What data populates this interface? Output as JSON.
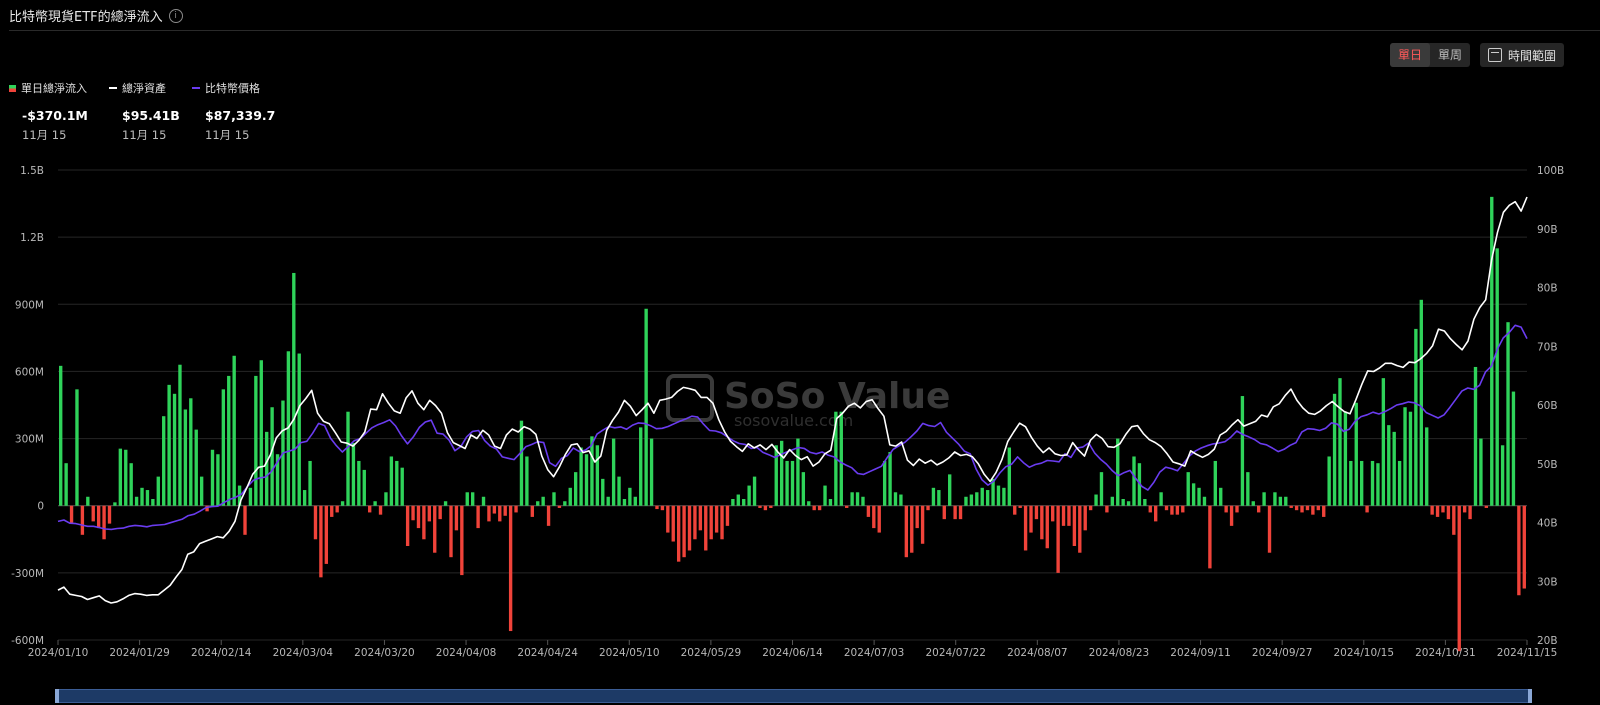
{
  "header": {
    "title": "比特幣現貨ETF的總淨流入",
    "info_icon": "info-icon"
  },
  "controls": {
    "daily_label": "單日",
    "weekly_label": "單周",
    "range_label": "時間範圍",
    "range_icon": "calendar-icon",
    "active_color": "#ff5a5a"
  },
  "legend": [
    {
      "label": "單日總淨流入",
      "value": "-$370.1M",
      "date": "11月 15"
    },
    {
      "label": "總淨資產",
      "value": "$95.41B",
      "date": "11月 15"
    },
    {
      "label": "比特幣價格",
      "value": "$87,339.7",
      "date": "11月 15"
    }
  ],
  "watermark": {
    "main": "SoSo Value",
    "sub": "sosovalue.com"
  },
  "colors": {
    "inflow": "#2fd35a",
    "outflow": "#f0433a",
    "net_assets": "#ffffff",
    "btc_price": "#6a3cf0"
  },
  "chart_data": {
    "type": "bar",
    "series": [
      {
        "name": "單日總淨流入",
        "type": "bar",
        "axis": "left",
        "unit": "USD",
        "values": [
          625,
          190,
          -75,
          520,
          -130,
          40,
          -70,
          -100,
          -150,
          -80,
          15,
          255,
          250,
          190,
          40,
          80,
          70,
          30,
          130,
          400,
          540,
          500,
          630,
          430,
          480,
          340,
          130,
          -25,
          250,
          230,
          520,
          580,
          670,
          90,
          -130,
          80,
          580,
          650,
          330,
          440,
          230,
          470,
          690,
          1040,
          680,
          70,
          200,
          -150,
          -320,
          -260,
          -50,
          -30,
          20,
          420,
          280,
          200,
          160,
          -30,
          20,
          -40,
          60,
          220,
          200,
          170,
          -180,
          -65,
          -100,
          -150,
          -70,
          -210,
          -60,
          20,
          -230,
          -110,
          -310,
          60,
          60,
          -100,
          40,
          -70,
          -35,
          -70,
          -45,
          -560,
          -30,
          380,
          220,
          -50,
          20,
          40,
          -90,
          60,
          -10,
          20,
          80,
          150,
          260,
          230,
          310,
          270,
          120,
          40,
          300,
          130,
          30,
          80,
          40,
          350,
          880,
          300,
          -15,
          -20,
          -120,
          -160,
          -250,
          -230,
          -200,
          -150,
          -110,
          -200,
          -150,
          -120,
          -150,
          -90,
          30,
          50,
          30,
          90,
          130,
          -10,
          -20,
          -10,
          270,
          290,
          200,
          200,
          300,
          150,
          20,
          -20,
          -20,
          90,
          30,
          420,
          420,
          -10,
          60,
          60,
          40,
          -50,
          -100,
          -120,
          200,
          240,
          60,
          50,
          -230,
          -210,
          -100,
          -170,
          -20,
          80,
          70,
          -60,
          140,
          -60,
          -60,
          40,
          50,
          60,
          80,
          70,
          120,
          90,
          80,
          260,
          -40,
          -10,
          -200,
          -120,
          -60,
          -150,
          -190,
          -70,
          -300,
          -90,
          -90,
          -180,
          -210,
          -110,
          -20,
          50,
          150,
          -30,
          40,
          300,
          30,
          20,
          220,
          190,
          30,
          -30,
          -70,
          60,
          -20,
          -40,
          -40,
          -30,
          150,
          100,
          80,
          40,
          -280,
          200,
          80,
          -30,
          -90,
          -30,
          490,
          150,
          20,
          -30,
          60,
          -210,
          60,
          40,
          40,
          -10,
          -20,
          -30,
          -20,
          -40,
          -20,
          -50,
          220,
          500,
          570,
          420,
          200,
          460,
          200,
          -30,
          200,
          190,
          570,
          360,
          330,
          200,
          440,
          420,
          790,
          920,
          350,
          -40,
          -50,
          -30,
          -60,
          -130,
          -650,
          -30,
          -60,
          620,
          300,
          -10,
          1380,
          1150,
          270,
          820,
          510,
          -400,
          -370
        ]
      },
      {
        "name": "總淨資產",
        "type": "line",
        "axis": "right",
        "unit": "B USD",
        "values": [
          28.5,
          29.0,
          27.8,
          27.6,
          27.4,
          26.9,
          27.2,
          27.5,
          26.7,
          26.3,
          26.5,
          27.0,
          27.6,
          27.9,
          27.8,
          27.6,
          27.7,
          27.7,
          28.5,
          29.3,
          30.7,
          32.0,
          34.6,
          35.0,
          36.4,
          36.8,
          37.2,
          37.6,
          37.4,
          38.5,
          40.2,
          43.8,
          45.9,
          48.2,
          49.4,
          49.6,
          51.5,
          54.4,
          55.6,
          56.1,
          57.6,
          59.9,
          61.1,
          62.5,
          58.6,
          57.2,
          56.8,
          55.3,
          53.7,
          53.5,
          53.0,
          54.0,
          55.4,
          59.3,
          59.2,
          61.9,
          60.3,
          59.0,
          58.6,
          61.2,
          62.4,
          60.3,
          59.2,
          60.8,
          59.9,
          58.6,
          55.3,
          53.6,
          53.1,
          52.6,
          54.9,
          54.3,
          55.7,
          54.9,
          53.0,
          52.6,
          54.9,
          55.9,
          55.4,
          56.3,
          55.9,
          55.0,
          51.3,
          49.0,
          47.8,
          49.5,
          51.6,
          53.2,
          53.4,
          51.9,
          52.2,
          50.3,
          51.3,
          55.7,
          57.4,
          58.8,
          60.8,
          59.8,
          58.2,
          59.2,
          60.3,
          58.6,
          60.8,
          61.0,
          61.3,
          62.3,
          63.0,
          62.8,
          62.5,
          61.3,
          61.3,
          60.3,
          57.5,
          55.4,
          53.8,
          52.9,
          52.1,
          53.4,
          52.7,
          53.2,
          52.4,
          53.3,
          52.0,
          51.0,
          52.4,
          51.4,
          50.7,
          51.2,
          49.6,
          50.3,
          51.7,
          52.3,
          57.7,
          58.6,
          59.8,
          60.3,
          59.5,
          60.6,
          60.9,
          59.4,
          58.1,
          53.2,
          53.0,
          53.7,
          50.6,
          49.7,
          50.8,
          50.1,
          50.6,
          49.8,
          50.3,
          51.0,
          52.0,
          51.4,
          51.6,
          51.2,
          50.0,
          48.2,
          47.0,
          48.5,
          50.7,
          53.8,
          55.4,
          56.9,
          56.3,
          54.5,
          53.0,
          51.9,
          52.7,
          51.7,
          51.4,
          51.5,
          53.6,
          52.3,
          51.3,
          54.0,
          55.0,
          54.3,
          52.9,
          52.8,
          53.4,
          55.0,
          56.3,
          56.5,
          55.1,
          54.1,
          53.6,
          52.9,
          51.7,
          50.3,
          50.0,
          49.6,
          52.2,
          51.6,
          51.1,
          51.6,
          52.5,
          54.9,
          55.5,
          56.6,
          57.5,
          56.4,
          56.8,
          57.2,
          58.3,
          58.0,
          59.7,
          60.2,
          61.6,
          62.7,
          60.8,
          59.5,
          58.6,
          58.4,
          59.0,
          59.9,
          60.6,
          59.7,
          58.9,
          58.5,
          60.9,
          63.5,
          65.8,
          65.7,
          66.3,
          67.1,
          67.1,
          66.7,
          66.4,
          67.3,
          67.2,
          67.9,
          68.8,
          70.1,
          72.9,
          72.6,
          71.3,
          70.3,
          69.4,
          70.9,
          74.6,
          76.6,
          77.9,
          84.7,
          89.4,
          92.8,
          94.0,
          94.6,
          93.0,
          95.41
        ]
      },
      {
        "name": "比特幣價格",
        "type": "line",
        "axis": "right",
        "unit": "USD",
        "values": [
          46500,
          46800,
          46100,
          46000,
          45700,
          45400,
          45400,
          45100,
          44800,
          44700,
          44900,
          45000,
          45400,
          45600,
          45500,
          45300,
          45600,
          45700,
          45800,
          46200,
          46600,
          47000,
          47800,
          48100,
          48800,
          49600,
          49800,
          49900,
          50700,
          51400,
          51900,
          52600,
          54300,
          55700,
          56200,
          56400,
          57600,
          59700,
          61800,
          62200,
          62600,
          64100,
          64400,
          66200,
          68400,
          67900,
          65100,
          63400,
          62000,
          63200,
          64500,
          65000,
          66200,
          67400,
          68100,
          68600,
          69200,
          67800,
          65600,
          63800,
          65400,
          67500,
          68700,
          69100,
          66200,
          66000,
          64700,
          62300,
          63200,
          65400,
          66600,
          66800,
          64600,
          63300,
          62700,
          60900,
          60600,
          60300,
          61700,
          63200,
          63700,
          64300,
          64100,
          59600,
          58800,
          60600,
          61200,
          62900,
          62100,
          62400,
          63400,
          66000,
          66900,
          67700,
          67400,
          67600,
          67100,
          68000,
          68500,
          68400,
          67900,
          67200,
          67300,
          67700,
          68300,
          68900,
          69400,
          70000,
          69800,
          68200,
          66800,
          66700,
          66300,
          65400,
          64500,
          63900,
          63700,
          62800,
          63000,
          61900,
          61400,
          60800,
          61400,
          62000,
          62500,
          63000,
          62800,
          61900,
          61600,
          62000,
          61300,
          60900,
          59800,
          59100,
          58500,
          57200,
          57000,
          57600,
          58200,
          58800,
          60800,
          62600,
          63400,
          64200,
          65400,
          66700,
          68400,
          67900,
          67700,
          68600,
          66400,
          65100,
          63800,
          62200,
          61600,
          58200,
          55800,
          54600,
          55500,
          57300,
          58700,
          59300,
          60900,
          59600,
          58600,
          59200,
          59500,
          60100,
          60000,
          59800,
          61600,
          60800,
          62900,
          63100,
          64000,
          61800,
          60400,
          59300,
          57800,
          56700,
          57400,
          57900,
          56000,
          54300,
          53500,
          55200,
          57500,
          58600,
          58300,
          57800,
          59400,
          61100,
          62200,
          62900,
          63400,
          63800,
          64000,
          64300,
          65300,
          66700,
          65900,
          65400,
          64800,
          63900,
          63600,
          62900,
          62100,
          62600,
          63500,
          64100,
          66500,
          67200,
          67100,
          66800,
          67300,
          68500,
          68200,
          66600,
          67100,
          68900,
          69900,
          70300,
          70900,
          70500,
          71000,
          71700,
          72500,
          72800,
          73200,
          73000,
          72300,
          70800,
          70200,
          69600,
          70300,
          72000,
          73800,
          75600,
          76300,
          76000,
          76900,
          79900,
          81200,
          85000,
          87500,
          88700,
          90300,
          89900,
          87339.7
        ]
      }
    ],
    "x_ticks": [
      "2024/01/10",
      "2024/01/29",
      "2024/02/14",
      "2024/03/04",
      "2024/03/20",
      "2024/04/08",
      "2024/04/24",
      "2024/05/10",
      "2024/05/29",
      "2024/06/14",
      "2024/07/03",
      "2024/07/22",
      "2024/08/07",
      "2024/08/23",
      "2024/09/11",
      "2024/09/27",
      "2024/10/15",
      "2024/10/31",
      "2024/11/15"
    ],
    "y_left_ticks": [
      "-600M",
      "-300M",
      "0",
      "300M",
      "600M",
      "900M",
      "1.2B",
      "1.5B"
    ],
    "y_left_range": [
      -600,
      1500
    ],
    "y_right_ticks": [
      "20B",
      "30B",
      "40B",
      "50B",
      "60B",
      "70B",
      "80B",
      "90B",
      "100B"
    ],
    "y_right_range": [
      20,
      100
    ],
    "price_range": [
      20000,
      125000
    ],
    "grid": true,
    "legend_position": "top-left"
  }
}
